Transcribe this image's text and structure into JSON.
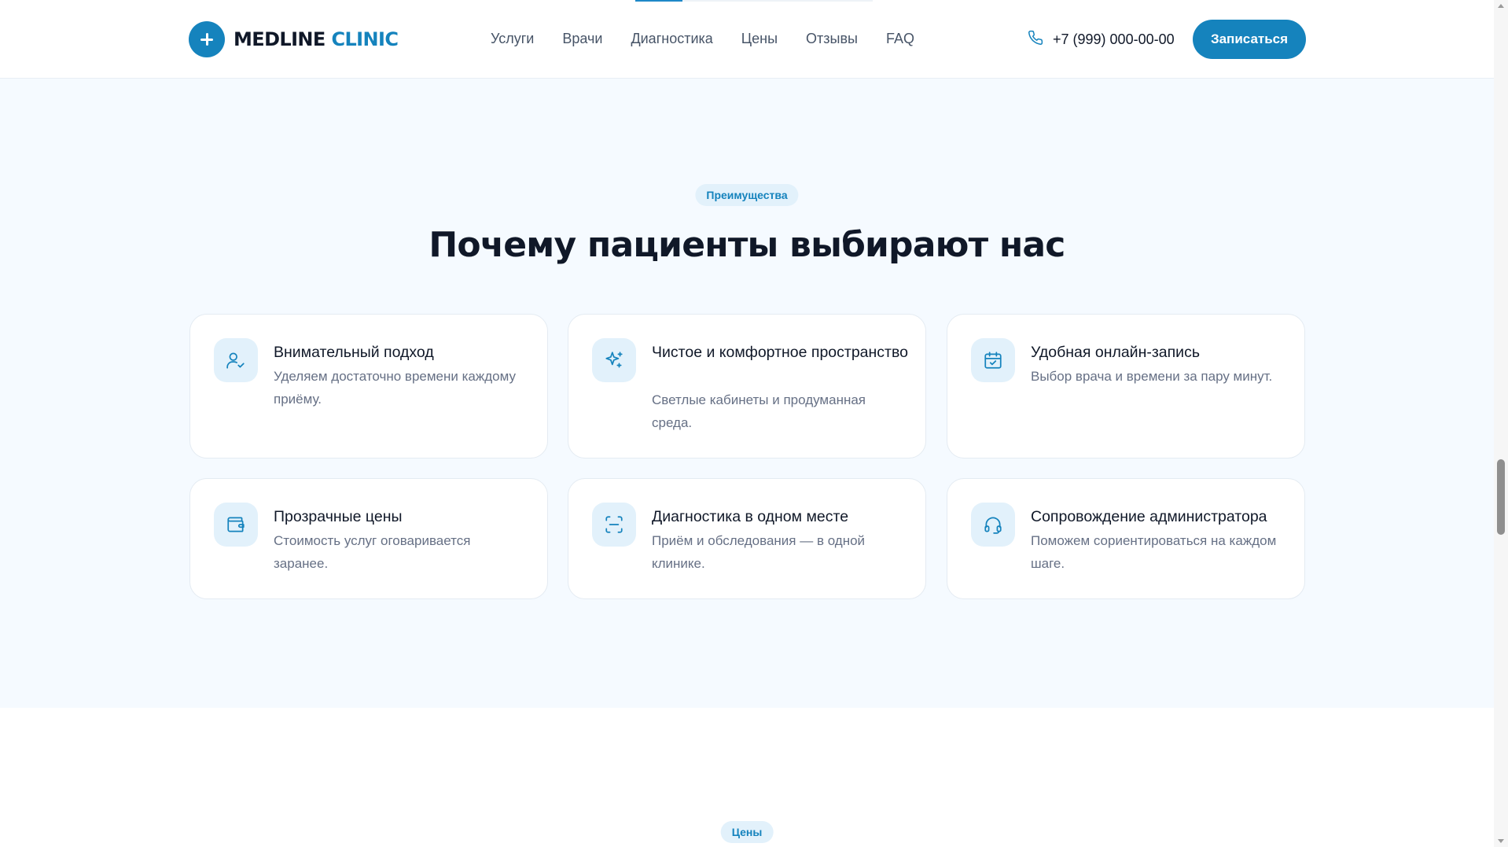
{
  "header": {
    "logo": {
      "part1": "MEDLINE",
      "part2": "CLINIC"
    },
    "nav": [
      "Услуги",
      "Врачи",
      "Диагностика",
      "Цены",
      "Отзывы",
      "FAQ"
    ],
    "phone": "+7 (999) 000-00-00",
    "cta_label": "Записаться"
  },
  "features": {
    "badge": "Преимущества",
    "title": "Почему пациенты выбирают нас",
    "cards": [
      {
        "icon": "user-check-icon",
        "title": "Внимательный подход",
        "text": "Уделяем достаточно времени каждому приёму."
      },
      {
        "icon": "sparkles-icon",
        "title": "Чистое и комфортное пространство",
        "text": "Светлые кабинеты и продуманная среда."
      },
      {
        "icon": "calendar-check-icon",
        "title": "Удобная онлайн-запись",
        "text": "Выбор врача и времени за пару минут."
      },
      {
        "icon": "wallet-icon",
        "title": "Прозрачные цены",
        "text": "Стоимость услуг оговаривается заранее."
      },
      {
        "icon": "scan-icon",
        "title": "Диагностика в одном месте",
        "text": "Приём и обследования — в одной клинике."
      },
      {
        "icon": "headset-icon",
        "title": "Сопровождение администратора",
        "text": "Поможем сориентироваться на каждом шаге."
      }
    ]
  },
  "prices": {
    "badge": "Цены"
  },
  "colors": {
    "accent": "#1583bd",
    "badge_bg": "#e2f1fb",
    "section_bg": "#f5faff"
  }
}
